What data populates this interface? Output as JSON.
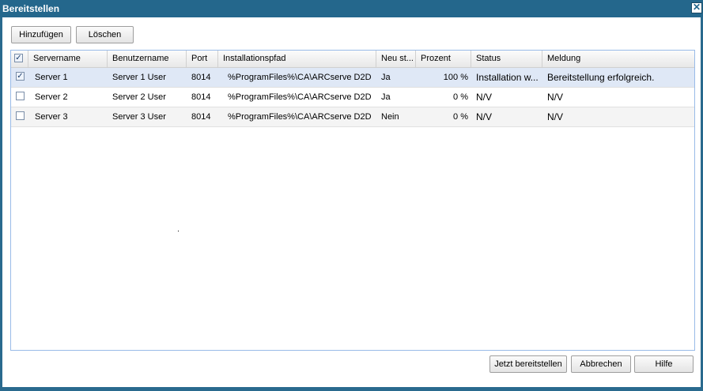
{
  "window": {
    "title": "Bereitstellen",
    "close_symbol": "✕"
  },
  "toolbar": {
    "add_label": "Hinzufügen",
    "delete_label": "Löschen"
  },
  "grid": {
    "columns": [
      "Servername",
      "Benutzername",
      "Port",
      "Installationspfad",
      "Neu st...",
      "Prozent",
      "Status",
      "Meldung"
    ],
    "header_checked": true,
    "rows": [
      {
        "checked": true,
        "server": "Server 1",
        "user": "Server 1 User",
        "port": "8014",
        "path": "%ProgramFiles%\\CA\\ARCserve D2D",
        "restart": "Ja",
        "percent": "100 %",
        "status": "Installation w...",
        "message": "Bereitstellung erfolgreich."
      },
      {
        "checked": false,
        "server": "Server 2",
        "user": "Server 2 User",
        "port": "8014",
        "path": "%ProgramFiles%\\CA\\ARCserve D2D",
        "restart": "Ja",
        "percent": "0 %",
        "status": "N/V",
        "message": "N/V"
      },
      {
        "checked": false,
        "server": "Server 3",
        "user": "Server 3 User",
        "port": "8014",
        "path": "%ProgramFiles%\\CA\\ARCserve D2D",
        "restart": "Nein",
        "percent": "0 %",
        "status": "N/V",
        "message": "N/V"
      }
    ]
  },
  "footer": {
    "deploy_label": "Jetzt bereitstellen",
    "cancel_label": "Abbrechen",
    "help_label": "Hilfe"
  },
  "colors": {
    "titlebar": "#24678c",
    "selected_row": "#dfe8f6",
    "grid_border": "#99bbe8"
  }
}
